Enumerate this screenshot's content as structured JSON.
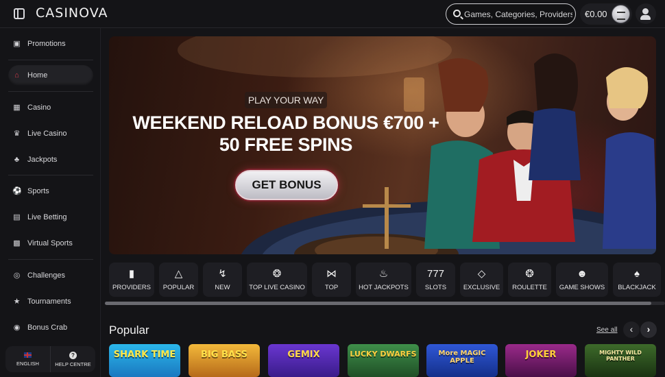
{
  "header": {
    "logo": "CASINOVA",
    "search_placeholder": "Games, Categories, Providers",
    "balance": "€0.00"
  },
  "sidebar": {
    "items": [
      {
        "label": "Promotions",
        "icon": "gift-icon"
      },
      {
        "label": "Home",
        "icon": "home-icon",
        "active": true
      },
      {
        "label": "Casino",
        "icon": "slot-machine-icon"
      },
      {
        "label": "Live Casino",
        "icon": "live-casino-icon"
      },
      {
        "label": "Jackpots",
        "icon": "clover-icon"
      },
      {
        "label": "Sports",
        "icon": "soccer-ball-icon"
      },
      {
        "label": "Live Betting",
        "icon": "live-icon"
      },
      {
        "label": "Virtual Sports",
        "icon": "monitor-icon"
      },
      {
        "label": "Challenges",
        "icon": "target-icon"
      },
      {
        "label": "Tournaments",
        "icon": "trophy-icon"
      },
      {
        "label": "Bonus Crab",
        "icon": "crab-icon"
      }
    ],
    "footer": {
      "language": "ENGLISH",
      "help": "HELP CENTRE"
    }
  },
  "hero": {
    "eyebrow": "PLAY YOUR WAY",
    "headline_line1": "WEEKEND RELOAD BONUS €700 +",
    "headline_line2": "50 FREE SPINS",
    "cta": "GET BONUS"
  },
  "categories": [
    {
      "label": "PROVIDERS",
      "icon": "providers-icon"
    },
    {
      "label": "POPULAR",
      "icon": "flame-icon"
    },
    {
      "label": "NEW",
      "icon": "lightning-icon"
    },
    {
      "label": "TOP LIVE CASINO",
      "icon": "roulette-wheel-icon"
    },
    {
      "label": "TOP",
      "icon": "bowtie-icon"
    },
    {
      "label": "HOT JACKPOTS",
      "icon": "hot-jackpot-icon"
    },
    {
      "label": "SLOTS",
      "icon": "slots-777-icon"
    },
    {
      "label": "EXCLUSIVE",
      "icon": "diamond-icon"
    },
    {
      "label": "ROULETTE",
      "icon": "roulette-icon"
    },
    {
      "label": "GAME SHOWS",
      "icon": "mask-icon"
    },
    {
      "label": "BLACKJACK",
      "icon": "cards-icon"
    }
  ],
  "popular": {
    "title": "Popular",
    "see_all": "See all",
    "games": [
      {
        "title": "SHARK TIME",
        "color": "#1a9fd6"
      },
      {
        "title": "BIG BASS",
        "color": "#e0a21b"
      },
      {
        "title": "GEMIX",
        "color": "#5a2ab8"
      },
      {
        "title": "LUCKY DWARFS",
        "color": "#2f7a3b"
      },
      {
        "title": "More MAGIC APPLE",
        "color": "#1b3fae"
      },
      {
        "title": "JOKER",
        "color": "#7a1a72"
      },
      {
        "title": "MIGHTY WILD PANTHER",
        "color": "#2e5a24"
      }
    ]
  },
  "colors": {
    "accent": "#d93a4c",
    "bg": "#141417"
  }
}
